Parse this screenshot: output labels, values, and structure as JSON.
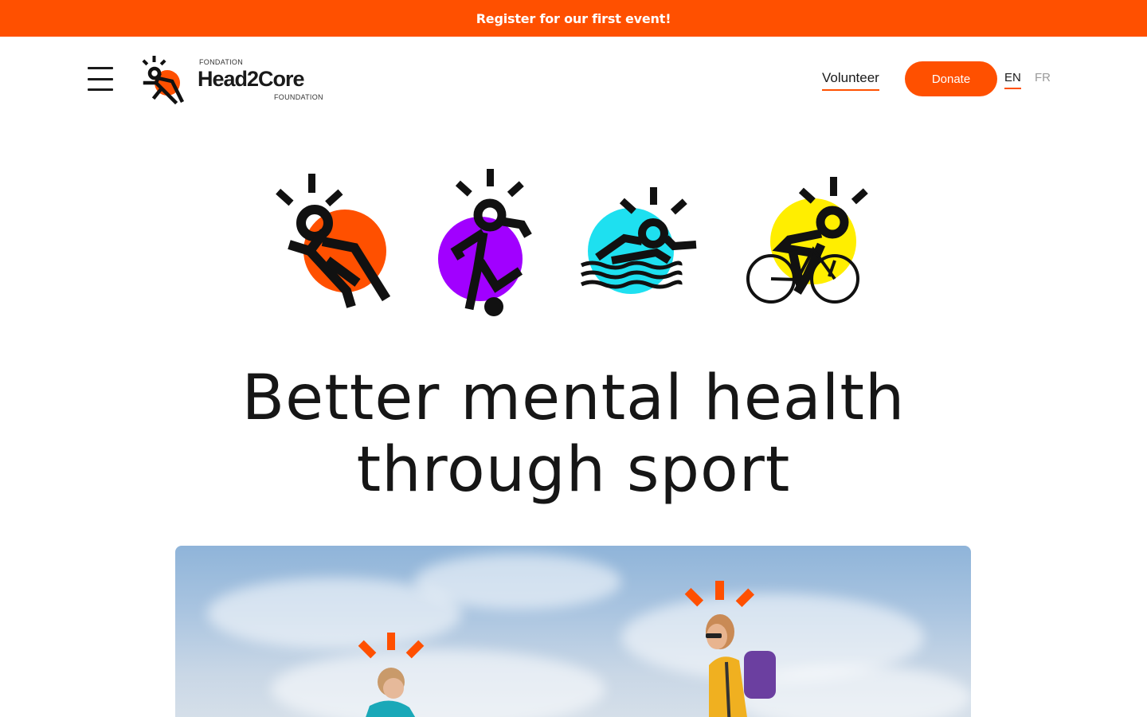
{
  "banner": {
    "text": "Register for our first event!"
  },
  "header": {
    "menu_icon": "hamburger-icon",
    "logo": {
      "small_top": "FONDATION",
      "name": "Head2Core",
      "small_bottom": "FOUNDATION"
    },
    "nav": {
      "volunteer": "Volunteer",
      "donate": "Donate",
      "lang_en": "EN",
      "lang_fr": "FR"
    }
  },
  "sports_icons": [
    {
      "name": "running-icon",
      "color": "#ff5000"
    },
    {
      "name": "soccer-icon",
      "color": "#a100ff"
    },
    {
      "name": "swimming-icon",
      "color": "#1ee0f0"
    },
    {
      "name": "cycling-icon",
      "color": "#ffee00"
    }
  ],
  "hero": {
    "headline_line1": "Better mental health",
    "headline_line2": "through sport"
  },
  "colors": {
    "brand_orange": "#ff5000",
    "text_dark": "#1a1a1a",
    "muted": "#9a9a9a"
  }
}
